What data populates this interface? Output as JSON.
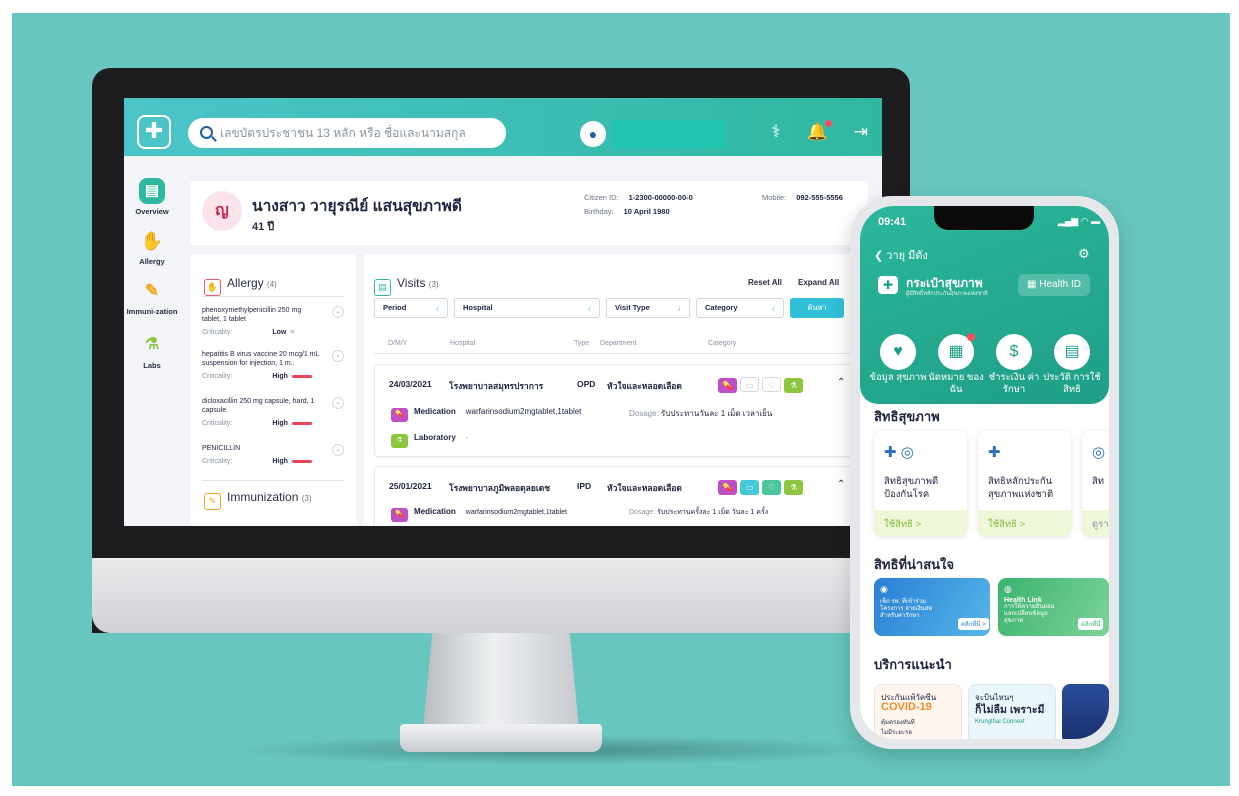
{
  "desktop": {
    "search_placeholder": "เลขบัตรประชาชน 13 หลัก หรือ ชื่อและนามสกุล",
    "sidebar": [
      {
        "label": "Overview",
        "icon": "id-card-icon"
      },
      {
        "label": "Allergy",
        "icon": "hand-icon"
      },
      {
        "label": "Immuni-zation",
        "icon": "syringe-icon"
      },
      {
        "label": "Labs",
        "icon": "flask-icon"
      }
    ],
    "patient": {
      "initial": "ญ",
      "name": "นางสาว วายุรณีย์ แสนสุขภาพดี",
      "age": "41 ปี",
      "citizen_label": "Citizen ID:",
      "citizen_id": "1-2300-00000-00-0",
      "birthday_label": "Birthday:",
      "birthday": "10 April 1980",
      "mobile_label": "Mobile:",
      "mobile": "092-555-5556"
    },
    "allergy": {
      "title": "Allergy",
      "count": "(4)",
      "items": [
        {
          "name": "phenoxymethylpenicillin 250 mg tablet, 1 tablet",
          "crit_label": "Criticality:",
          "crit": "Low"
        },
        {
          "name": "hepatitis B virus vaccine 20 mcg/1 mL suspension for injection, 1 m..",
          "crit_label": "Criticality:",
          "crit": "High"
        },
        {
          "name": "dicloxacillin 250 mg capsule, hard, 1 capsule",
          "crit_label": "Criticality:",
          "crit": "High"
        },
        {
          "name": "PENICILLIN",
          "crit_label": "Criticality:",
          "crit": "High"
        }
      ]
    },
    "immunization": {
      "title": "Immunization",
      "count": "(3)"
    },
    "visits": {
      "title": "Visits",
      "count": "(3)",
      "reset": "Reset All",
      "expand": "Expand All",
      "filters": [
        "Period",
        "Hospital",
        "Visit Type",
        "Category"
      ],
      "search_btn": "ค้นหา",
      "columns": [
        "D/M/Y",
        "Hospital",
        "Type",
        "Department",
        "Category"
      ],
      "rows": [
        {
          "date": "24/03/2021",
          "hospital": "โรงพยาบาลสมุทรปราการ",
          "type": "OPD",
          "dept": "หัวใจและหลอดเลือด",
          "med_label": "Medication",
          "med_value": "warfarinsodium2mgtablet,1tablet",
          "dosage_label": "Dosage:",
          "dosage": "รับประทานวันละ 1 เม็ด เวลาเย็น",
          "lab_label": "Laboratory"
        },
        {
          "date": "25/01/2021",
          "hospital": "โรงพยาบาลภูมิพลอดุลยเดช",
          "type": "IPD",
          "dept": "หัวใจและหลอดเลือด",
          "med_label": "Medication",
          "med_value": "warfarinsodium2mgtablet,1tablet",
          "dosage_label": "Dosage:",
          "dosage": "รับประทานครั้งละ 1 เม็ด วันละ 1 ครั้ง"
        }
      ]
    }
  },
  "mobile": {
    "time": "09:41",
    "back_label": "วายุ มีตัง",
    "wallet_title": "กระเป๋าสุขภาพ",
    "wallet_sub": "ผู้มีสิทธิ์หลักประกันสุขภาพแห่งชาติ",
    "health_id": "Health ID",
    "quick": [
      {
        "label": "ข้อมูล สุขภาพ",
        "icon": "heart-icon"
      },
      {
        "label": "นัดหมาย ของฉัน",
        "icon": "calendar-icon"
      },
      {
        "label": "ชำระเงิน ค่ารักษา",
        "icon": "payment-icon"
      },
      {
        "label": "ประวัติ การใช้สิทธิ",
        "icon": "history-icon"
      }
    ],
    "rights_title": "สิทธิสุขภาพ",
    "rights": [
      {
        "text": "สิทธิสุขภาพดี ป้องกันโรค",
        "action": "ใช้สิทธิ >"
      },
      {
        "text": "สิทธิหลักประกัน สุขภาพแห่งชาติ",
        "action": "ใช้สิทธิ >"
      },
      {
        "text": "สิท",
        "action": "ดูรา"
      }
    ],
    "interest_title": "สิทธิที่น่าสนใจ",
    "banner1": {
      "text": "เช็ก รพ. ที่เข้าร่วมโครงการ จ่ายเงินสดสำหรับค่ารักษา",
      "cta": "คลิกที่นี่ >"
    },
    "banner2": {
      "title": "Health Link",
      "text": "การให้ความยินยอม แลกเปลี่ยนข้อมูลสุขภาพ",
      "cta": "คลิกที่นี่"
    },
    "services_title": "บริการแนะนำ",
    "svc1": {
      "line1": "ประกันแพ้วัคซีน",
      "line2": "COVID-19",
      "line3": "คุ้มครองทันที ไม่มีระยะรอ"
    },
    "svc2": {
      "line1": "จะบินไหนๆ",
      "line2": "ก็ไม่ลืม เพราะมี",
      "line3": "Krungthai Connext"
    }
  }
}
